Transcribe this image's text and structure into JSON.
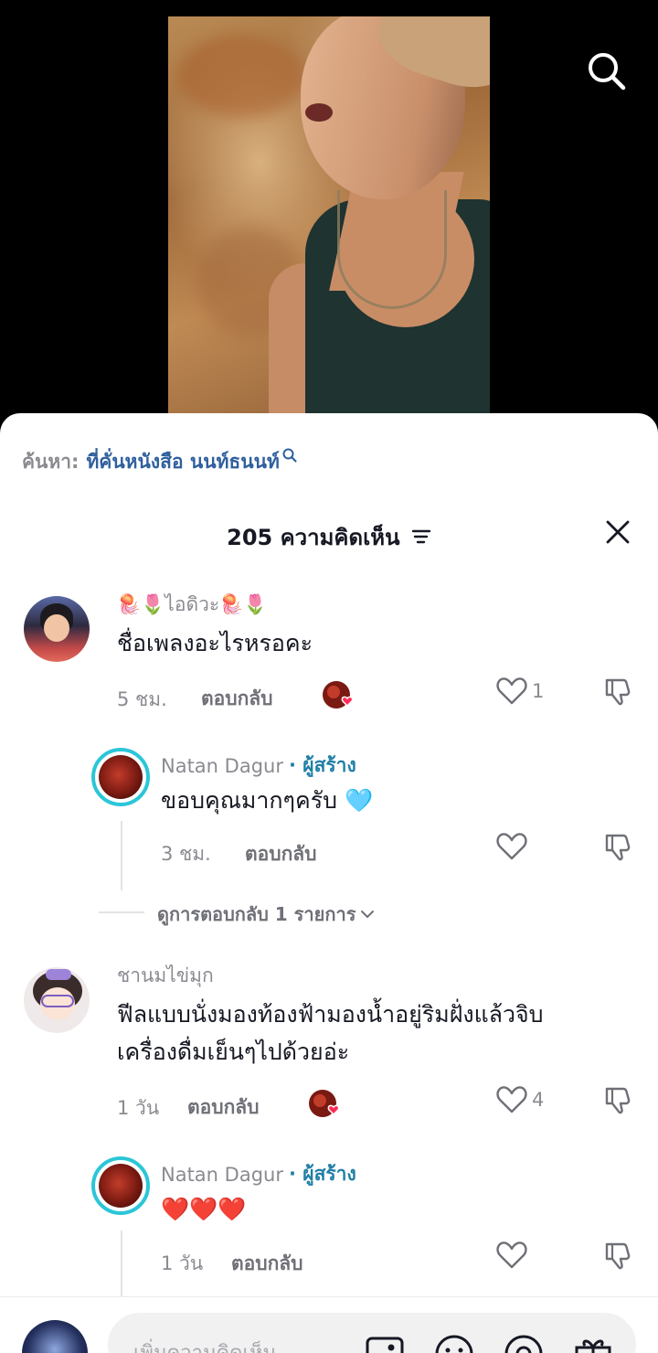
{
  "search_hint": {
    "prefix": "ค้นหา:",
    "term": "ที่คั่นหนังสือ นนท์ธนนท์"
  },
  "sheet": {
    "title": "205 ความคิดเห็น"
  },
  "comments": [
    {
      "name": "🪼🌷ไอดิวะ🪼🌷",
      "text": "ชื่อเพลงอะไรหรอคะ",
      "time": "5 ชม.",
      "reply_label": "ตอบกลับ",
      "likes": "1",
      "creator_liked": true,
      "replies": [
        {
          "name": "Natan Dagur",
          "creator_label": "· ผู้สร้าง",
          "text": "ขอบคุณมากๆครับ 🩵",
          "time": "3 ชม.",
          "reply_label": "ตอบกลับ",
          "likes": ""
        }
      ],
      "view_more": "ดูการตอบกลับ 1 รายการ"
    },
    {
      "name": "ชานมไข่มุก",
      "text_lines": [
        "ฟีลแบบนั่งมองท้องฟ้ามองน้ำอยู่ริมฝั่งแล้วจิบ",
        "เครื่องดื่มเย็นๆไปด้วยอ่ะ"
      ],
      "time": "1 วัน",
      "reply_label": "ตอบกลับ",
      "likes": "4",
      "creator_liked": true,
      "replies": [
        {
          "name": "Natan Dagur",
          "creator_label": "· ผู้สร้าง",
          "text": "❤️❤️❤️",
          "time": "1 วัน",
          "reply_label": "ตอบกลับ",
          "likes": ""
        }
      ]
    }
  ],
  "input": {
    "placeholder": "เพิ่มความคิดเห็น..."
  },
  "icons": [
    "search-icon",
    "sort-icon",
    "close-icon",
    "heart-icon",
    "dislike-icon",
    "liked-by-creator-badge",
    "image-icon",
    "emoji-icon",
    "mention-icon",
    "gift-icon"
  ],
  "colors": {
    "creator_tag": "#1f7ea6",
    "search_term": "#2f5f9e",
    "creator_ring": "#2bc6d8",
    "like_badge": "#fe2c55"
  }
}
